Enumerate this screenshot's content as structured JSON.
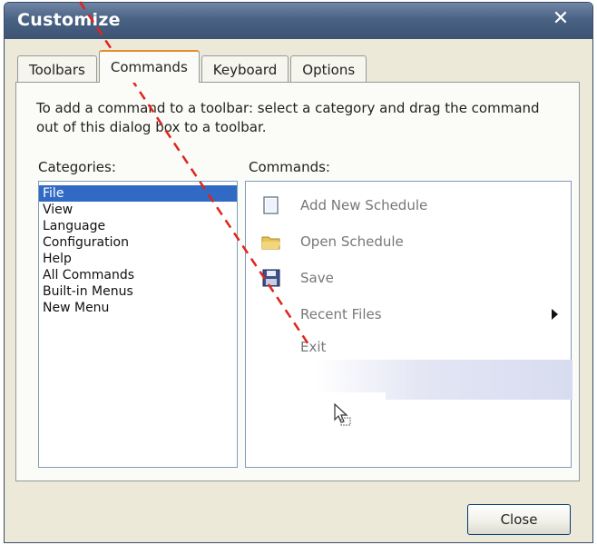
{
  "window": {
    "title": "Customize",
    "close_glyph": "✕"
  },
  "tabs": [
    {
      "label": "Toolbars",
      "active": false
    },
    {
      "label": "Commands",
      "active": true
    },
    {
      "label": "Keyboard",
      "active": false
    },
    {
      "label": "Options",
      "active": false
    }
  ],
  "panel": {
    "description": "To add a command to a toolbar: select a category and drag the command out of this dialog box to a toolbar.",
    "categories_label": "Categories:",
    "commands_label": "Commands:"
  },
  "categories": [
    {
      "label": "File",
      "selected": true
    },
    {
      "label": "View",
      "selected": false
    },
    {
      "label": "Language",
      "selected": false
    },
    {
      "label": "Configuration",
      "selected": false
    },
    {
      "label": "Help",
      "selected": false
    },
    {
      "label": "All Commands",
      "selected": false
    },
    {
      "label": "Built-in Menus",
      "selected": false
    },
    {
      "label": "New Menu",
      "selected": false
    }
  ],
  "commands": [
    {
      "label": "Add New Schedule",
      "icon": "new-document-icon"
    },
    {
      "label": "Open Schedule",
      "icon": "open-folder-icon"
    },
    {
      "label": "Save",
      "icon": "floppy-disk-icon"
    },
    {
      "label": "Recent Files",
      "icon": "none",
      "submenu": true
    },
    {
      "label": "Exit",
      "icon": "none"
    }
  ],
  "footer": {
    "close_label": "Close"
  },
  "colors": {
    "title_bar": "#4a6283",
    "dialog_bg": "#ece9d8",
    "selection": "#316ac5",
    "active_tab_accent": "#e68b2c",
    "annotation_dash": "#e0241b"
  }
}
